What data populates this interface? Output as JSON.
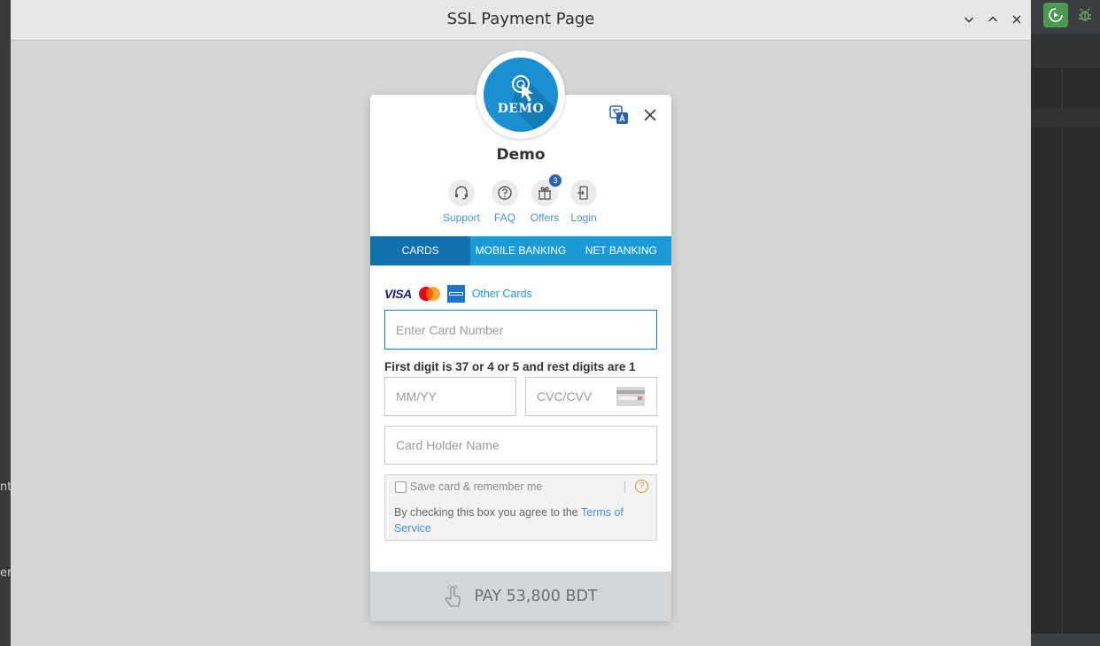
{
  "window": {
    "title": "SSL Payment Page"
  },
  "background": {
    "left_fragment_1": "nt",
    "left_fragment_2": "er"
  },
  "merchant": {
    "logo_text": "DEMO",
    "name": "Demo"
  },
  "quick_links": [
    {
      "label": "Support",
      "icon": "headset-icon"
    },
    {
      "label": "FAQ",
      "icon": "question-icon"
    },
    {
      "label": "Offers",
      "icon": "gift-icon",
      "badge": "3"
    },
    {
      "label": "Login",
      "icon": "login-icon"
    }
  ],
  "tabs": [
    {
      "label": "CARDS",
      "active": true
    },
    {
      "label": "MOBILE BANKING",
      "active": false
    },
    {
      "label": "NET BANKING",
      "active": false
    }
  ],
  "card_brands": {
    "visa": "VISA",
    "other_cards": "Other Cards"
  },
  "form": {
    "card_number_placeholder": "Enter Card Number",
    "hint": "First digit is 37 or 4 or 5 and rest digits are 1",
    "expiry_placeholder": "MM/YY",
    "cvc_placeholder": "CVC/CVV",
    "holder_placeholder": "Card Holder Name",
    "save_label": "Save card & remember me",
    "agree_text": "By checking this box you agree to the ",
    "terms_link": "Terms of Service"
  },
  "pay": {
    "label": "PAY 53,800 BDT"
  },
  "colors": {
    "primary": "#1b9ad8",
    "active_tab": "#0f72ad",
    "link": "#4a90d9",
    "pay_button": "#d4d7da"
  }
}
